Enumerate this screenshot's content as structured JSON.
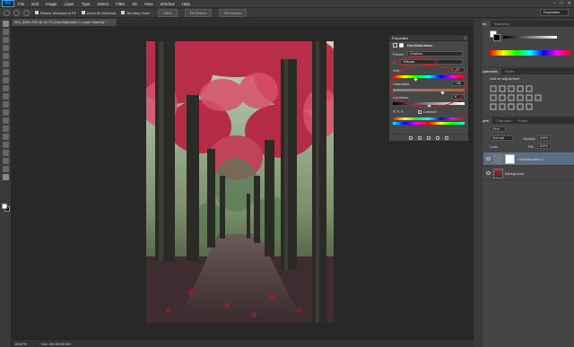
{
  "app": {
    "logo": "Ps",
    "menu": [
      "File",
      "Edit",
      "Image",
      "Layer",
      "Type",
      "Select",
      "Filter",
      "3D",
      "View",
      "Window",
      "Help"
    ],
    "window_controls": [
      "–",
      "□",
      "✕"
    ]
  },
  "options_bar": {
    "resize_label": "Resize Windows to Fit",
    "zoom_all_label": "Zoom All Windows",
    "scrubby_label": "Scrubby Zoom",
    "buttons": [
      "100%",
      "Fit Screen",
      "Fill Screen"
    ],
    "workspace": "Essentials"
  },
  "document": {
    "tab_title": "IMG_6081.CR2 @ 16.7% (Hue/Saturation 1, Layer Mask/8) *",
    "zoom": "16.67%",
    "doc_info": "Doc: 66.3M/99.5M"
  },
  "properties": {
    "tab": "Properties",
    "title": "Hue/Saturation",
    "preset_label": "Preset:",
    "preset_value": "Custom",
    "channel_value": "Yellows",
    "hue_label": "Hue:",
    "hue_value": "-47",
    "saturation_label": "Saturation:",
    "saturation_value": "+35",
    "lightness_label": "Lightness:",
    "lightness_value": "0",
    "colorize_label": "Colorize"
  },
  "color_panel": {
    "tabs": [
      "Color",
      "Swatches"
    ]
  },
  "adjustments_panel": {
    "tabs": [
      "Adjustments",
      "Styles"
    ],
    "hint": "Add an adjustment"
  },
  "layers_panel": {
    "tabs": [
      "Layers",
      "Channels",
      "Paths"
    ],
    "kind_filter": "Kind",
    "blend_mode": "Normal",
    "opacity_label": "Opacity:",
    "opacity_value": "100%",
    "lock_label": "Lock:",
    "fill_label": "Fill:",
    "fill_value": "100%",
    "layers": [
      {
        "name": "Hue/Saturation 1"
      },
      {
        "name": "Background"
      }
    ]
  },
  "colors": {
    "accent": "#31a8ff",
    "annotation": "#e11b1b",
    "panel": "#474747",
    "canvas_bg": "#282828"
  }
}
